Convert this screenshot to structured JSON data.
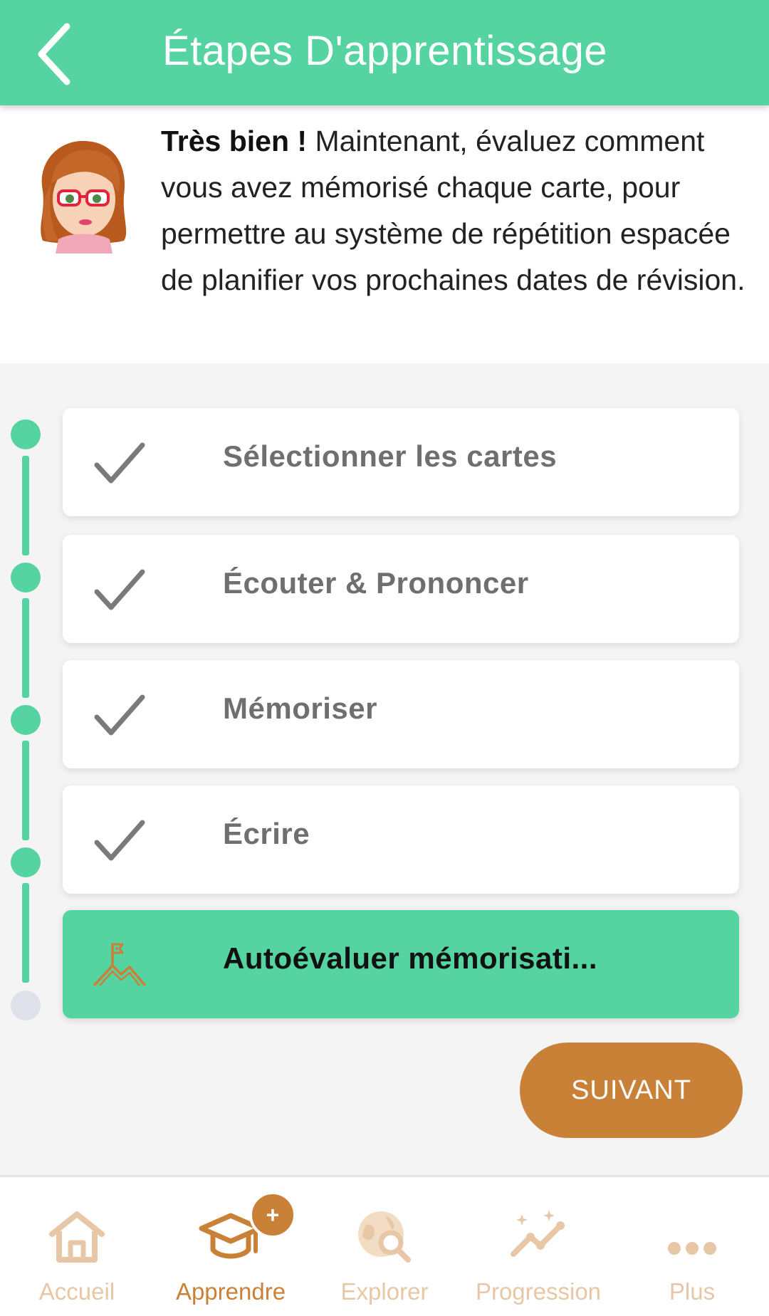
{
  "header": {
    "title": "Étapes D'apprentissage",
    "back_icon": "chevron-left-icon"
  },
  "intro": {
    "bold_text": "Très bien !",
    "text": " Maintenant, évaluez comment vous avez mémorisé chaque carte, pour permettre au système de répétition espacée de planifier vos prochaines dates de révision."
  },
  "steps": [
    {
      "label": "Sélectionner les cartes",
      "status": "done",
      "icon": "check-icon"
    },
    {
      "label": "Écouter & Prononcer",
      "status": "done",
      "icon": "check-icon"
    },
    {
      "label": "Mémoriser",
      "status": "done",
      "icon": "check-icon"
    },
    {
      "label": "Écrire",
      "status": "done",
      "icon": "check-icon"
    },
    {
      "label": "Autoévaluer mémorisati...",
      "status": "current",
      "icon": "mountain-flag-icon"
    }
  ],
  "next_button": {
    "label": "SUIVANT"
  },
  "bottom_nav": {
    "items": [
      {
        "label": "Accueil",
        "icon": "home-icon",
        "active": false
      },
      {
        "label": "Apprendre",
        "icon": "graduation-cap-icon",
        "active": true,
        "badge": "+"
      },
      {
        "label": "Explorer",
        "icon": "globe-search-icon",
        "active": false
      },
      {
        "label": "Progression",
        "icon": "trend-chart-icon",
        "active": false
      },
      {
        "label": "Plus",
        "icon": "more-dots-icon",
        "active": false
      }
    ]
  },
  "colors": {
    "accent_green": "#55d3a0",
    "accent_orange": "#c98138",
    "nav_inactive": "#e7c7a5",
    "pending_dot": "#dfe2ea"
  }
}
